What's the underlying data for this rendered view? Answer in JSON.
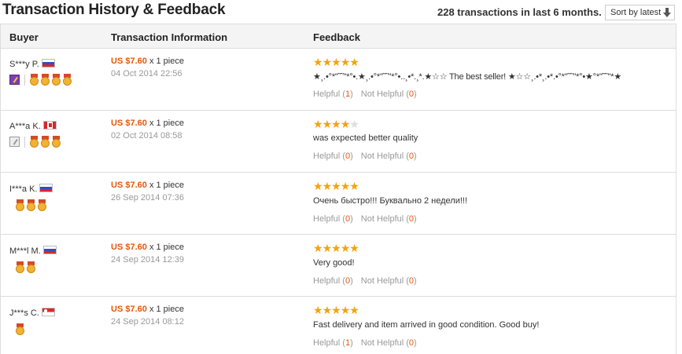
{
  "header": {
    "title": "Transaction History & Feedback",
    "summary": "228 transactions in last 6 months.",
    "sort_label": "Sort by latest"
  },
  "columns": {
    "buyer": "Buyer",
    "transaction": "Transaction Information",
    "feedback": "Feedback"
  },
  "labels": {
    "helpful": "Helpful (",
    "not_helpful": "Not Helpful (",
    "close": ")"
  },
  "rows": [
    {
      "buyer": "S***y P.",
      "flag": "russia-flag",
      "price": "US $7.60",
      "qty": "x 1 piece",
      "date": "04 Oct 2014 22:56",
      "rating": 5,
      "feedback": "★¸.•°*\"˜˜\"*°•.★¸.•°*\"˜˜\"*°•..¸•*.¸*.★☆☆ The best seller! ★☆☆¸.•*¸.•*.•°*\"˜˜\"*°•★°*\"˜˜\"*★",
      "helpful": "1",
      "not_helpful": "0"
    },
    {
      "buyer": "A***a K.",
      "flag": "canada-flag",
      "price": "US $7.60",
      "qty": "x 1 piece",
      "date": "02 Oct 2014 08:58",
      "rating": 4,
      "feedback": "was expected better quality",
      "helpful": "0",
      "not_helpful": "0"
    },
    {
      "buyer": "I***a K.",
      "flag": "russia-flag",
      "price": "US $7.60",
      "qty": "x 1 piece",
      "date": "26 Sep 2014 07:36",
      "rating": 5,
      "feedback": "Очень быстро!!! Буквально 2 недели!!!",
      "helpful": "0",
      "not_helpful": "0"
    },
    {
      "buyer": "M***l M.",
      "flag": "russia-flag",
      "price": "US $7.60",
      "qty": "x 1 piece",
      "date": "24 Sep 2014 12:39",
      "rating": 5,
      "feedback": "Very good!",
      "helpful": "0",
      "not_helpful": "0"
    },
    {
      "buyer": "J***s C.",
      "flag": "singapore-flag",
      "price": "US $7.60",
      "qty": "x 1 piece",
      "date": "24 Sep 2014 08:12",
      "rating": 5,
      "feedback": "Fast delivery and item arrived in good condition. Good buy!",
      "helpful": "1",
      "not_helpful": "0"
    }
  ],
  "colors": {
    "price": "#e5570c",
    "star": "#f5a30a",
    "muted": "#999999"
  }
}
